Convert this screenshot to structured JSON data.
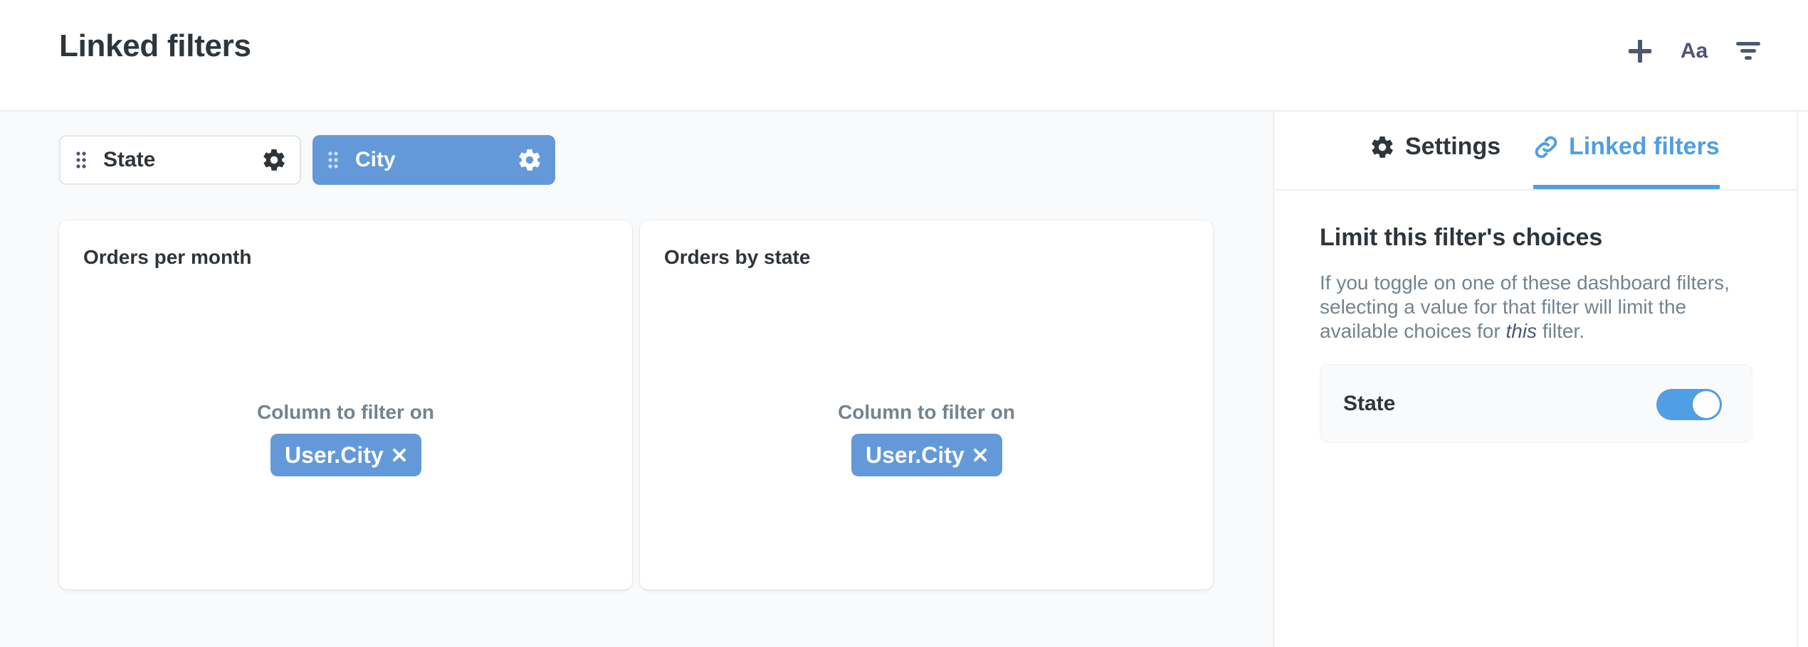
{
  "header": {
    "title": "Linked filters",
    "text_button_label": "Aa"
  },
  "filters": [
    {
      "label": "State",
      "active": false
    },
    {
      "label": "City",
      "active": true
    }
  ],
  "cards": [
    {
      "title": "Orders per month",
      "caption": "Column to filter on",
      "column": "User.City"
    },
    {
      "title": "Orders by state",
      "caption": "Column to filter on",
      "column": "User.City"
    }
  ],
  "sidebar": {
    "tabs": [
      {
        "label": "Settings",
        "icon": "gear-icon"
      },
      {
        "label": "Linked filters",
        "icon": "link-icon"
      }
    ],
    "active_tab": "Linked filters",
    "heading": "Limit this filter's choices",
    "description_before": "If you toggle on one of these dashboard filters, selecting a value for that filter will limit the available choices for ",
    "description_emphasis": "this",
    "description_after": " filter.",
    "toggles": [
      {
        "label": "State",
        "on": true
      }
    ]
  },
  "colors": {
    "brand": "#509ee3",
    "chip_active": "#6399d9",
    "text_dark": "#2e353b",
    "text_muted": "#74838f"
  }
}
